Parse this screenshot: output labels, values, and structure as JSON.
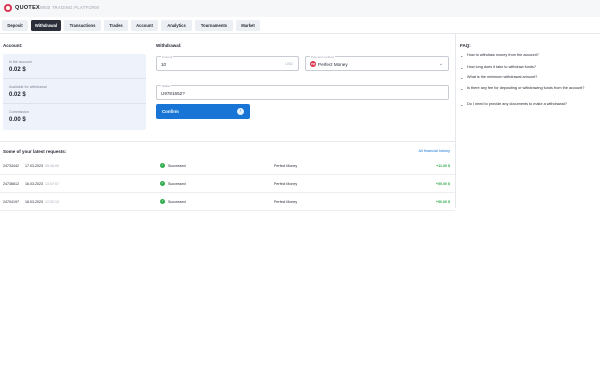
{
  "header": {
    "brand": "QUOTEX",
    "platform": "WEB TRADING PLATFORM"
  },
  "tabs": [
    {
      "label": "Deposit",
      "active": false
    },
    {
      "label": "Withdrawal",
      "active": true
    },
    {
      "label": "Transactions",
      "active": false
    },
    {
      "label": "Trades",
      "active": false
    },
    {
      "label": "Account",
      "active": false
    },
    {
      "label": "Analytics",
      "active": false
    },
    {
      "label": "Tournaments",
      "active": false
    },
    {
      "label": "Market",
      "active": false
    }
  ],
  "account": {
    "title": "Account:",
    "rows": [
      {
        "label": "In the account",
        "value": "0.02 $"
      },
      {
        "label": "Available for withdrawal",
        "value": "0.02 $"
      },
      {
        "label": "Commission",
        "value": "0.00 $"
      }
    ]
  },
  "withdrawal": {
    "title": "Withdrawal:",
    "amount_label": "Amount",
    "amount_value": "10",
    "currency": "USD",
    "method_label": "Payment method",
    "method_icon": "PM",
    "method_value": "Perfect Money",
    "wallet_label": "Wallet",
    "wallet_value": "U9781652?",
    "confirm_label": "Confirm"
  },
  "faq": {
    "title": "FAQ:",
    "items": [
      "How to withdraw money from the account?",
      "How long does it take to withdraw funds?",
      "What is the minimum withdrawal amount?",
      "Is there any fee for depositing or withdrawing funds from the account?",
      "Do I need to provide any documents to make a withdrawal?"
    ]
  },
  "requests": {
    "title": "Some of your latest requests:",
    "link": "All financial history",
    "rows": [
      {
        "id": "24733442",
        "date": "17.03.2023",
        "time": "05:45:00",
        "status": "Successed",
        "method": "Perfect Money",
        "amount": "+11.00 $"
      },
      {
        "id": "24736612",
        "date": "16.03.2023",
        "time": "13:07:07",
        "status": "Successed",
        "method": "Perfect Money",
        "amount": "+50.00 $"
      },
      {
        "id": "24704197",
        "date": "16.03.2023",
        "time": "12:32:13",
        "status": "Successed",
        "method": "Perfect Money",
        "amount": "+50.00 $"
      }
    ]
  },
  "colors": {
    "accent": "#1875d6",
    "success": "#2faa4a",
    "brand": "#e0344d",
    "active_tab": "#2c2f3a"
  }
}
